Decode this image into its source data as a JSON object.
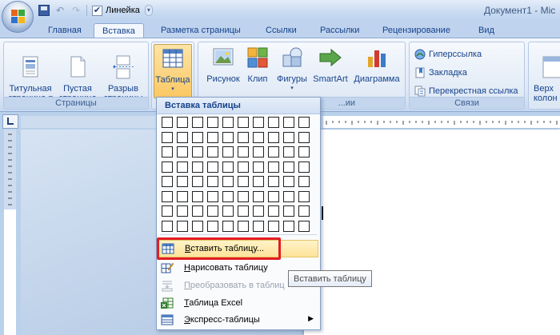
{
  "window": {
    "title": "Документ1 - Mic"
  },
  "quick_access": {
    "ruler_label": "Линейка",
    "ruler_checked": "✔"
  },
  "tabs": [
    {
      "label": "Главная",
      "active": false
    },
    {
      "label": "Вставка",
      "active": true
    },
    {
      "label": "Разметка страницы",
      "active": false
    },
    {
      "label": "Ссылки",
      "active": false
    },
    {
      "label": "Рассылки",
      "active": false
    },
    {
      "label": "Рецензирование",
      "active": false
    },
    {
      "label": "Вид",
      "active": false
    }
  ],
  "ribbon": {
    "pages_group": {
      "label": "Страницы",
      "cover_page": "Титульная\nстраница ▾",
      "blank_page": "Пустая\nстраница",
      "page_break": "Разрыв\nстраницы"
    },
    "tables_group": {
      "table_label": "Таблица"
    },
    "illustrations_group": {
      "label": "...ии",
      "picture": "Рисунок",
      "clipart": "Клип",
      "shapes": "Фигуры",
      "smartart": "SmartArt",
      "chart": "Диаграмма"
    },
    "links_group": {
      "label": "Связи",
      "hyperlink": "Гиперссылка",
      "bookmark": "Закладка",
      "cross_reference": "Перекрестная ссылка"
    },
    "header_group": {
      "label_partial": "Верх\nколон"
    }
  },
  "dropdown": {
    "header": "Вставка таблицы",
    "grid_cols": 10,
    "grid_rows": 8,
    "items": {
      "insert_table_prefix": "",
      "insert_table_accel": "В",
      "insert_table_rest": "ставить таблицу...",
      "draw_table_accel": "Н",
      "draw_table_rest": "арисовать таблицу",
      "convert_prefix": "П",
      "convert_rest": "реобразовать в таблиц",
      "excel_accel": "Т",
      "excel_rest": "аблица Excel",
      "quick_accel": "Э",
      "quick_rest": "кспресс-таблицы"
    }
  },
  "tooltip": {
    "text": "Вставить таблицу"
  },
  "colors": {
    "highlight_border": "#e11d24",
    "ribbon_text": "#15428b"
  }
}
